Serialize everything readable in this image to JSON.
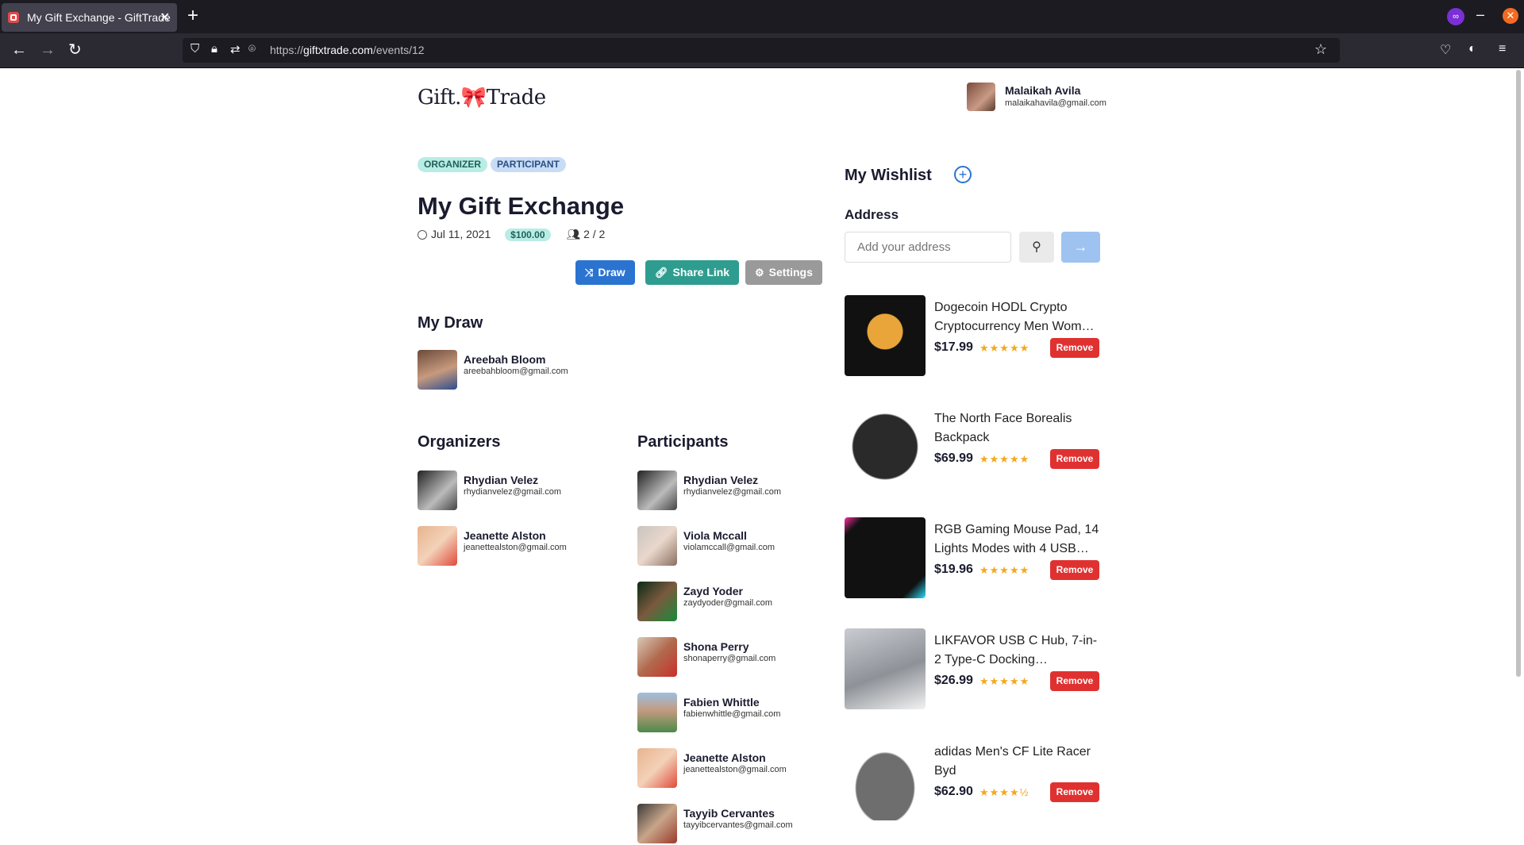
{
  "browser": {
    "tab_title": "My Gift Exchange - GiftTrade",
    "url_prefix": "https://",
    "url_host": "giftxtrade.com",
    "url_path": "/events/12"
  },
  "header": {
    "logo_left": "Gift.",
    "logo_bow": "🎀",
    "logo_right": "Trade",
    "user": {
      "name": "Malaikah Avila",
      "email": "malaikahavila@gmail.com"
    }
  },
  "event": {
    "badges": [
      "ORGANIZER",
      "PARTICIPANT"
    ],
    "title": "My Gift Exchange",
    "date": "Jul 11, 2021",
    "price": "$100.00",
    "participants_count": "2 / 2",
    "actions": {
      "draw": "Draw",
      "share": "Share Link",
      "settings": "Settings"
    }
  },
  "my_draw": {
    "heading": "My Draw",
    "person": {
      "name": "Areebah Bloom",
      "email": "areebahbloom@gmail.com"
    }
  },
  "organizers": {
    "heading": "Organizers",
    "people": [
      {
        "name": "Rhydian Velez",
        "email": "rhydianvelez@gmail.com"
      },
      {
        "name": "Jeanette Alston",
        "email": "jeanettealston@gmail.com"
      }
    ]
  },
  "participants": {
    "heading": "Participants",
    "people": [
      {
        "name": "Rhydian Velez",
        "email": "rhydianvelez@gmail.com"
      },
      {
        "name": "Viola Mccall",
        "email": "violamccall@gmail.com"
      },
      {
        "name": "Zayd Yoder",
        "email": "zaydyoder@gmail.com"
      },
      {
        "name": "Shona Perry",
        "email": "shonaperry@gmail.com"
      },
      {
        "name": "Fabien Whittle",
        "email": "fabienwhittle@gmail.com"
      },
      {
        "name": "Jeanette Alston",
        "email": "jeanettealston@gmail.com"
      },
      {
        "name": "Tayyib Cervantes",
        "email": "tayyibcervantes@gmail.com"
      }
    ]
  },
  "wishlist": {
    "heading": "My Wishlist",
    "address_label": "Address",
    "address_placeholder": "Add your address",
    "remove_label": "Remove",
    "items": [
      {
        "title": "Dogecoin HODL Crypto Cryptocurrency Men Wom…",
        "price": "$17.99",
        "rating": "★★★★★"
      },
      {
        "title": "The North Face Borealis Backpack",
        "price": "$69.99",
        "rating": "★★★★★"
      },
      {
        "title": "RGB Gaming Mouse Pad, 14 Lights Modes with 4 USB…",
        "price": "$19.96",
        "rating": "★★★★★"
      },
      {
        "title": "LIKFAVOR USB C Hub, 7-in-2 Type-C Docking…",
        "price": "$26.99",
        "rating": "★★★★★"
      },
      {
        "title": "adidas Men's CF Lite Racer Byd",
        "price": "$62.90",
        "rating": "★★★★½"
      }
    ]
  }
}
